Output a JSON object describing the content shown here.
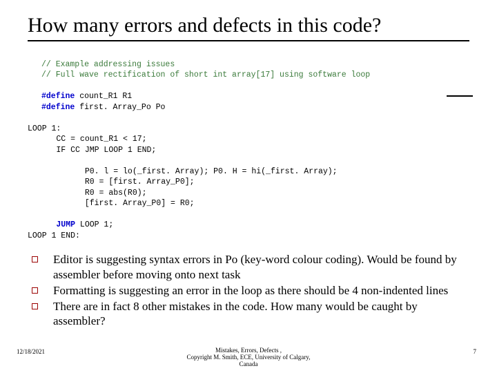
{
  "title": "How many errors and defects in this code?",
  "code": {
    "c1": "// Example addressing issues",
    "c2": "// Full wave rectification of short int array[17] using software loop",
    "d1a": "#define",
    "d1b": " count_R1 R1",
    "d2a": "#define",
    "d2b": " first. Array_Po Po",
    "l1": "LOOP 1:",
    "l2": "      CC = count_R1 < 17;",
    "l3": "      IF CC JMP LOOP 1 END;",
    "l4": "            P0. l = lo(_first. Array); P0. H = hi(_first. Array);",
    "l5": "            R0 = [first. Array_P0];",
    "l6": "            R0 = abs(R0);",
    "l7": "            [first. Array_P0] = R0;",
    "l8a": "      JUMP",
    "l8b": " LOOP 1;",
    "l9": "LOOP 1 END:"
  },
  "bullets": [
    "Editor is suggesting syntax errors in Po (key-word colour coding). Would be found by assembler before moving onto next task",
    "Formatting is suggesting an error in the loop as there should be 4 non-indented lines",
    "There are in fact 8 other mistakes in the code. How many would be caught by assembler?"
  ],
  "footer": {
    "date": "12/18/2021",
    "center_line1": "Mistakes, Errors, Defects                     ,",
    "center_line2": "Copyright M. Smith, ECE, University of Calgary,",
    "center_line3": "Canada",
    "page": "7"
  }
}
